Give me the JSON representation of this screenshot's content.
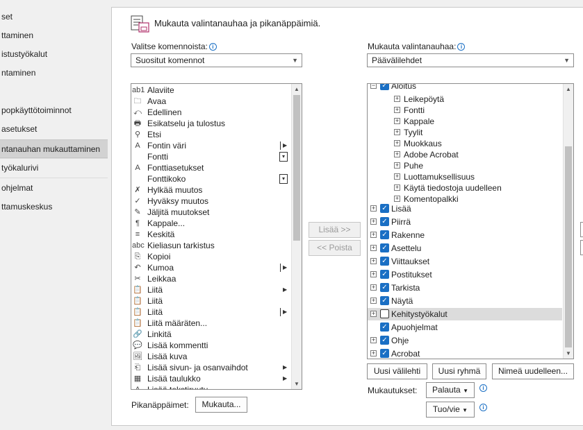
{
  "nav": {
    "items": [
      {
        "label": "set",
        "selected": false
      },
      {
        "label": "ttaminen",
        "selected": false
      },
      {
        "label": "istustyökalut",
        "selected": false
      },
      {
        "label": "ntaminen",
        "selected": false
      },
      {
        "label": "",
        "selected": false
      },
      {
        "label": "popkäyttötoiminnot",
        "selected": false
      },
      {
        "label": "asetukset",
        "selected": false
      },
      {
        "label": "ntanauhan mukauttaminen",
        "selected": true
      },
      {
        "label": "työkalurivi",
        "selected": false
      },
      {
        "label": "ohjelmat",
        "selected": false
      },
      {
        "label": "ttamuskeskus",
        "selected": false
      }
    ]
  },
  "header": {
    "title": "Mukauta valintanauhaa ja pikanäppäimiä.",
    "icon": "customize-ribbon-icon"
  },
  "left": {
    "label": "Valitse komennoista:",
    "dropdown_value": "Suositut komennot",
    "commands": [
      {
        "label": "Alaviite",
        "icon": "ab1"
      },
      {
        "label": "Avaa",
        "icon": "🗀"
      },
      {
        "label": "Edellinen",
        "icon": "⤺"
      },
      {
        "label": "Esikatselu ja tulostus",
        "icon": "🖶"
      },
      {
        "label": "Etsi",
        "icon": "⚲"
      },
      {
        "label": "Fontin väri",
        "icon": "A",
        "submenu": "arrow"
      },
      {
        "label": "Fontti",
        "icon": "",
        "submenu": "spin"
      },
      {
        "label": "Fonttiasetukset",
        "icon": "A"
      },
      {
        "label": "Fonttikoko",
        "icon": "",
        "submenu": "spin"
      },
      {
        "label": "Hylkää muutos",
        "icon": "✗"
      },
      {
        "label": "Hyväksy muutos",
        "icon": "✓"
      },
      {
        "label": "Jäljitä muutokset",
        "icon": "✎"
      },
      {
        "label": "Kappale...",
        "icon": "¶"
      },
      {
        "label": "Keskitä",
        "icon": "≡"
      },
      {
        "label": "Kieliasun tarkistus",
        "icon": "abc"
      },
      {
        "label": "Kopioi",
        "icon": "⎘"
      },
      {
        "label": "Kumoa",
        "icon": "↶",
        "submenu": "arrow"
      },
      {
        "label": "Leikkaa",
        "icon": "✂"
      },
      {
        "label": "Liitä",
        "icon": "📋",
        "submenu": "arrow-plain"
      },
      {
        "label": "Liitä",
        "icon": "📋"
      },
      {
        "label": "Liitä",
        "icon": "📋",
        "submenu": "arrow"
      },
      {
        "label": "Liitä määräten...",
        "icon": "📋"
      },
      {
        "label": "Linkitä",
        "icon": "🔗"
      },
      {
        "label": "Lisää kommentti",
        "icon": "💬"
      },
      {
        "label": "Lisää kuva",
        "icon": "🖼"
      },
      {
        "label": "Lisää sivun- ja osanvaihdot",
        "icon": "⎗",
        "submenu": "arrow-plain"
      },
      {
        "label": "Lisää taulukko",
        "icon": "▦",
        "submenu": "arrow-plain"
      },
      {
        "label": "Lisää tekstiruutu",
        "icon": "A"
      }
    ],
    "shortcuts_label": "Pikanäppäimet:",
    "customize_button": "Mukauta..."
  },
  "middle": {
    "add_button": "Lisää >>",
    "remove_button": "<< Poista"
  },
  "right": {
    "label": "Mukauta valintanauhaa:",
    "dropdown_value": "Päävälilehdet",
    "tree": [
      {
        "label": "Aloitus",
        "level": 0,
        "checked": true,
        "expand": "minus"
      },
      {
        "label": "Leikepöytä",
        "level": 1,
        "expand": "plus"
      },
      {
        "label": "Fontti",
        "level": 1,
        "expand": "plus"
      },
      {
        "label": "Kappale",
        "level": 1,
        "expand": "plus"
      },
      {
        "label": "Tyylit",
        "level": 1,
        "expand": "plus"
      },
      {
        "label": "Muokkaus",
        "level": 1,
        "expand": "plus"
      },
      {
        "label": "Adobe Acrobat",
        "level": 1,
        "expand": "plus"
      },
      {
        "label": "Puhe",
        "level": 1,
        "expand": "plus"
      },
      {
        "label": "Luottamuksellisuus",
        "level": 1,
        "expand": "plus"
      },
      {
        "label": "Käytä tiedostoja uudelleen",
        "level": 1,
        "expand": "plus"
      },
      {
        "label": "Komentopalkki",
        "level": 1,
        "expand": "plus"
      },
      {
        "label": "Lisää",
        "level": 0,
        "checked": true,
        "expand": "plus"
      },
      {
        "label": "Piirrä",
        "level": 0,
        "checked": true,
        "expand": "plus"
      },
      {
        "label": "Rakenne",
        "level": 0,
        "checked": true,
        "expand": "plus"
      },
      {
        "label": "Asettelu",
        "level": 0,
        "checked": true,
        "expand": "plus"
      },
      {
        "label": "Viittaukset",
        "level": 0,
        "checked": true,
        "expand": "plus"
      },
      {
        "label": "Postitukset",
        "level": 0,
        "checked": true,
        "expand": "plus"
      },
      {
        "label": "Tarkista",
        "level": 0,
        "checked": true,
        "expand": "plus"
      },
      {
        "label": "Näytä",
        "level": 0,
        "checked": true,
        "expand": "plus"
      },
      {
        "label": "Kehitystyökalut",
        "level": 0,
        "checked": false,
        "expand": "plus",
        "selected": true
      },
      {
        "label": "Apuohjelmat",
        "level": 0,
        "checked": true,
        "expand": "none"
      },
      {
        "label": "Ohje",
        "level": 0,
        "checked": true,
        "expand": "plus"
      },
      {
        "label": "Acrobat",
        "level": 0,
        "checked": true,
        "expand": "plus"
      }
    ],
    "new_tab_button": "Uusi välilehti",
    "new_group_button": "Uusi ryhmä",
    "rename_button": "Nimeä uudelleen...",
    "customizations_label": "Mukautukset:",
    "reset_button": "Palauta",
    "import_export_button": "Tuo/vie"
  },
  "colors": {
    "accent": "#1a6fc4",
    "selected_row": "#dcdcdc",
    "nav_selected": "#d2d2d2"
  }
}
